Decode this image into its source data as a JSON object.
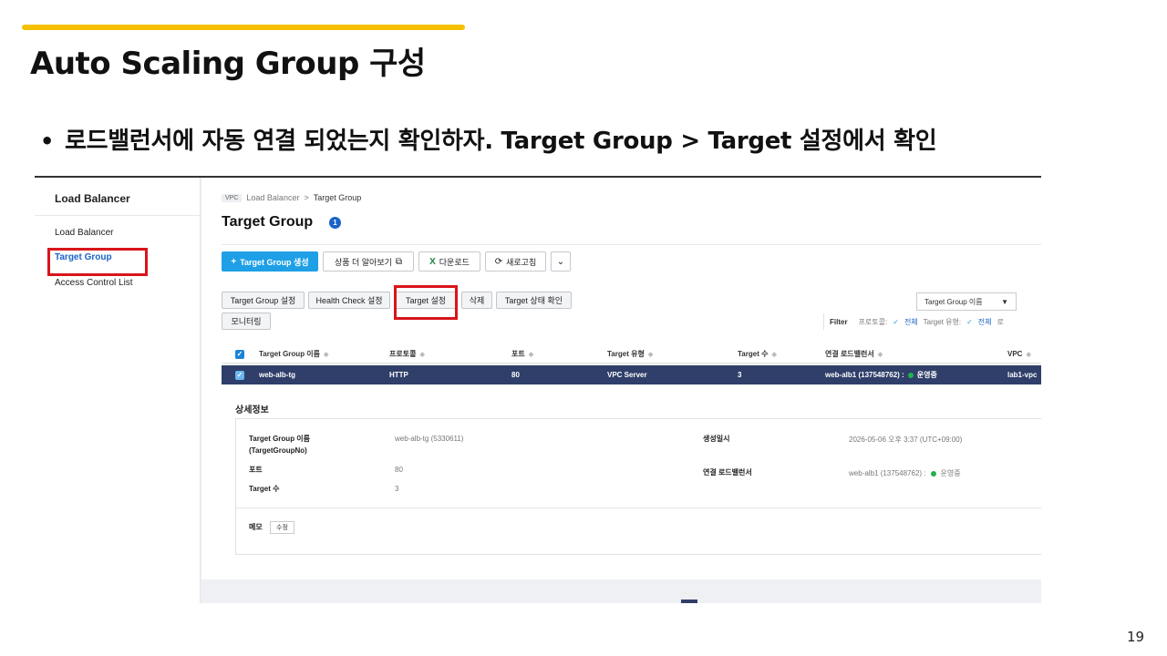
{
  "slide": {
    "title": "Auto Scaling Group 구성",
    "bullet": "로드밸런서에 자동 연결 되었는지 확인하자.  Target Group > Target 설정에서 확인",
    "page_number": "19",
    "accent_color": "#f5c000",
    "highlight_color": "#d9141b"
  },
  "sidebar": {
    "header": "Load Balancer",
    "items": [
      {
        "label": "Load Balancer",
        "active": false
      },
      {
        "label": "Target Group",
        "active": true
      },
      {
        "label": "Access Control List",
        "active": false
      }
    ]
  },
  "breadcrumb": {
    "badge": "VPC",
    "parent": "Load Balancer",
    "separator": ">",
    "current": "Target Group"
  },
  "page": {
    "title": "Target Group",
    "count_badge": "1"
  },
  "toolbar": {
    "create_label": "Target Group 생성",
    "learn_more_label": "상품 더 알아보기",
    "download_label": "다운로드",
    "refresh_label": "새로고침"
  },
  "actions": {
    "tg_settings": "Target Group 설정",
    "health_check": "Health Check 설정",
    "target_settings": "Target 설정",
    "delete": "삭제",
    "target_status": "Target 상태 확인",
    "monitoring": "모니터링"
  },
  "search": {
    "selected_field": "Target Group 이름"
  },
  "filter": {
    "label": "Filter",
    "protocol_label": "프로토콜:",
    "protocol_value": "전체",
    "type_label": "Target 유형:",
    "type_value": "전체",
    "more": "로"
  },
  "table": {
    "columns": [
      "Target Group 이름",
      "프로토콜",
      "포트",
      "Target 유형",
      "Target 수",
      "연결 로드밸런서",
      "VPC"
    ],
    "rows": [
      {
        "name": "web-alb-tg",
        "protocol": "HTTP",
        "port": "80",
        "type": "VPC Server",
        "count": "3",
        "lb": "web-alb1 (137548762) :",
        "lb_status": "운영중",
        "vpc": "lab1-vpc"
      }
    ]
  },
  "detail": {
    "title": "상세정보",
    "tg_name_label_1": "Target Group 이름",
    "tg_name_label_2": "(TargetGroupNo)",
    "tg_name_value": "web-alb-tg (5330611)",
    "port_label": "포트",
    "port_value": "80",
    "count_label": "Target 수",
    "count_value": "3",
    "created_label": "생성일시",
    "created_value": "2026-05-06 오후 3:37 (UTC+09:00)",
    "lb_label": "연결 로드밸런서",
    "lb_value": "web-alb1 (137548762) :",
    "lb_status": "운영중",
    "memo_label": "메모",
    "memo_edit": "수정"
  }
}
